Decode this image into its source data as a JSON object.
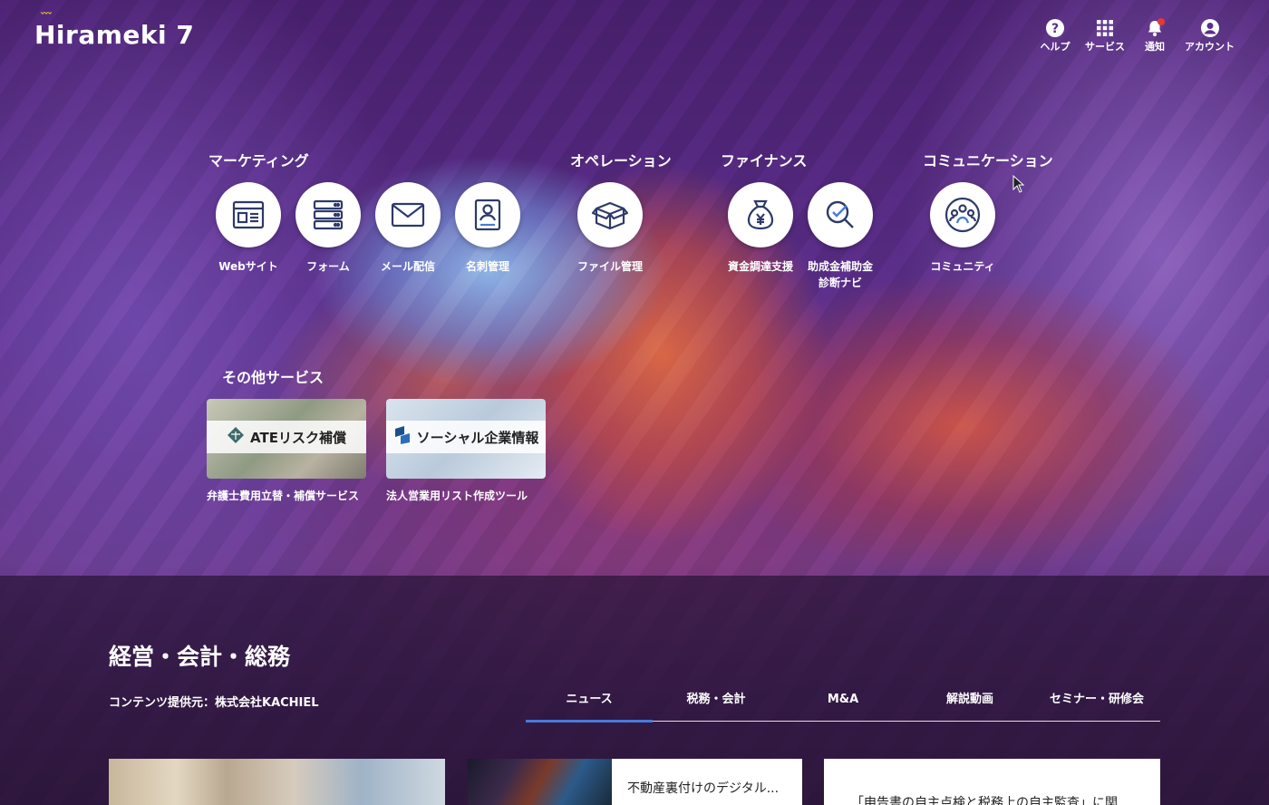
{
  "header": {
    "logo_text": "Hirameki 7",
    "nav": [
      {
        "label": "ヘルプ",
        "icon": "help-icon"
      },
      {
        "label": "サービス",
        "icon": "grid-icon"
      },
      {
        "label": "通知",
        "icon": "bell-icon"
      },
      {
        "label": "アカウント",
        "icon": "account-icon"
      }
    ]
  },
  "sections": {
    "marketing": {
      "title": "マーケティング",
      "items": [
        {
          "label": "Webサイト",
          "icon": "website-icon"
        },
        {
          "label": "フォーム",
          "icon": "form-icon"
        },
        {
          "label": "メール配信",
          "icon": "mail-icon"
        },
        {
          "label": "名刺管理",
          "icon": "business-card-icon"
        }
      ]
    },
    "operation": {
      "title": "オペレーション",
      "items": [
        {
          "label": "ファイル管理",
          "icon": "box-icon"
        }
      ]
    },
    "finance": {
      "title": "ファイナンス",
      "items": [
        {
          "label": "資金調達支援",
          "icon": "money-bag-icon"
        },
        {
          "label": "助成金補助金\n診断ナビ",
          "icon": "magnifier-check-icon"
        }
      ]
    },
    "communication": {
      "title": "コミュニケーション",
      "items": [
        {
          "label": "コミュニティ",
          "icon": "community-icon"
        }
      ]
    }
  },
  "other_services": {
    "title": "その他サービス",
    "banners": [
      {
        "banner_text": "ATEリスク補償",
        "caption": "弁護士費用立替・補償サービス"
      },
      {
        "banner_text": "ソーシャル企業情報",
        "caption": "法人営業用リスト作成ツール"
      }
    ]
  },
  "content": {
    "title": "経営・会計・総務",
    "provider": "コンテンツ提供元：株式会社KACHIEL",
    "tabs": [
      "ニュース",
      "税務・会計",
      "M&A",
      "解説動画",
      "セミナー・研修会"
    ],
    "active_tab": 0,
    "cards": [
      {
        "text": ""
      },
      {
        "text": "不動産裏付けのデジタル..."
      },
      {
        "text": "「申告書の自主点検と税務上の自主監査」に関"
      }
    ]
  },
  "colors": {
    "accent": "#4a7ad6",
    "notification": "#e53935",
    "icon_stroke": "#2d3a6b",
    "logo_spark": "#f2c230"
  }
}
